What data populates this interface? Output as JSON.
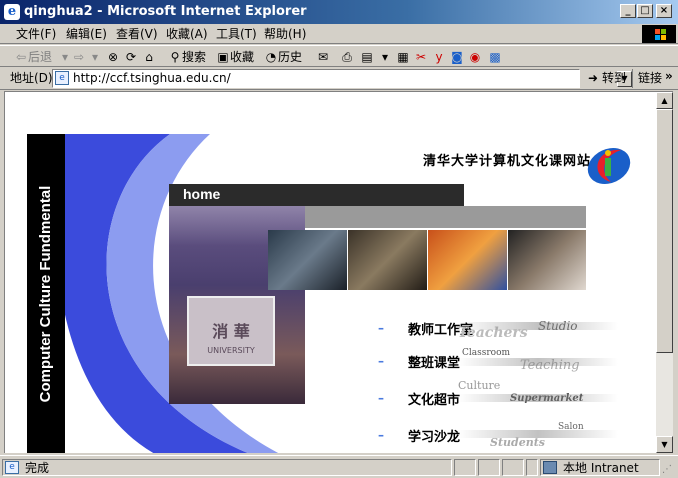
{
  "window": {
    "title": "qinghua2 - Microsoft Internet Explorer",
    "icon_letter": "e"
  },
  "menubar": [
    "文件(F)",
    "编辑(E)",
    "查看(V)",
    "收藏(A)",
    "工具(T)",
    "帮助(H)"
  ],
  "toolbar": {
    "back": "后退",
    "search": "搜索",
    "favorites": "收藏",
    "history": "历史"
  },
  "address": {
    "label": "地址(D)",
    "url": "http://ccf.tsinghua.edu.cn/",
    "go": "转到",
    "links": "链接"
  },
  "page": {
    "vertical_title": "Computer Culture Fundmental",
    "site_title": "清华大学计算机文化课网站",
    "home_tab": "home",
    "gate_text_1": "消 華",
    "gate_text_2": "UNIVERSITY",
    "nav": [
      {
        "label": "教师工作室",
        "deco_1": "Teachers",
        "deco_2": "Studio"
      },
      {
        "label": "整班课堂",
        "deco_1": "Classroom",
        "deco_2": "Teaching"
      },
      {
        "label": "文化超市",
        "deco_1": "Culture",
        "deco_2": "Supermarket"
      },
      {
        "label": "学习沙龙",
        "deco_1": "Students",
        "deco_2": "Salon"
      }
    ]
  },
  "status": {
    "text": "完成",
    "zone": "本地 Intranet"
  },
  "colors": {
    "titlebar": "#0a246a",
    "band_blue": "#3b4bdc",
    "band_light": "#8c9cf0",
    "dark_bar": "#2b2b2b",
    "grey_bar": "#9a9a9a",
    "bullet": "#4a7adf"
  }
}
